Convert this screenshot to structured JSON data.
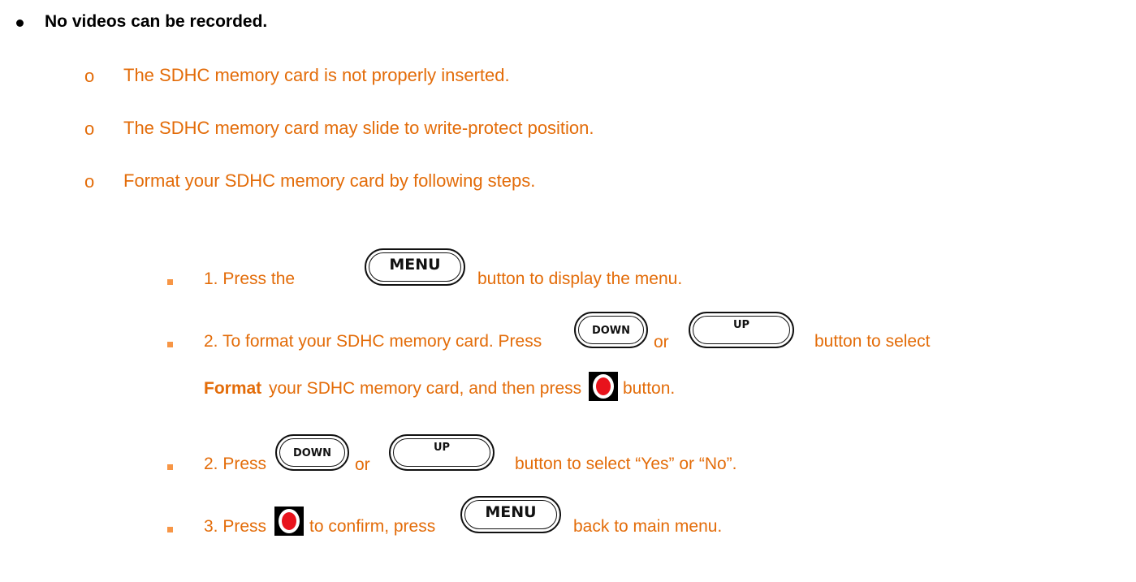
{
  "colors": {
    "text_orange": "#E36C09",
    "heading_black": "#000000",
    "bullet_orange": "#F79646",
    "record_red": "#E8131C"
  },
  "heading": {
    "text": "No videos can be recorded."
  },
  "causes": {
    "marker": "o",
    "items": [
      "The SDHC memory card is not properly inserted.",
      "The SDHC memory card may slide to write-protect position.",
      "Format your SDHC memory card by following steps."
    ]
  },
  "buttons": {
    "menu": "MENU",
    "down": "DOWN",
    "up": "UP",
    "record_icon": "record-button-icon"
  },
  "steps": {
    "s1": {
      "pre": "1. Press the",
      "post": "button to display the menu."
    },
    "s2": {
      "pre": "2. To format your SDHC memory card. Press",
      "or": "or",
      "post": "button to select",
      "bold": "Format",
      "cont": "your SDHC memory card, and then press",
      "end": "button."
    },
    "s3": {
      "pre": "2. Press",
      "or": "or",
      "post": "button to select “Yes” or “No”."
    },
    "s4": {
      "pre": "3. Press",
      "mid": "to confirm, press",
      "post": "back to main menu."
    }
  }
}
